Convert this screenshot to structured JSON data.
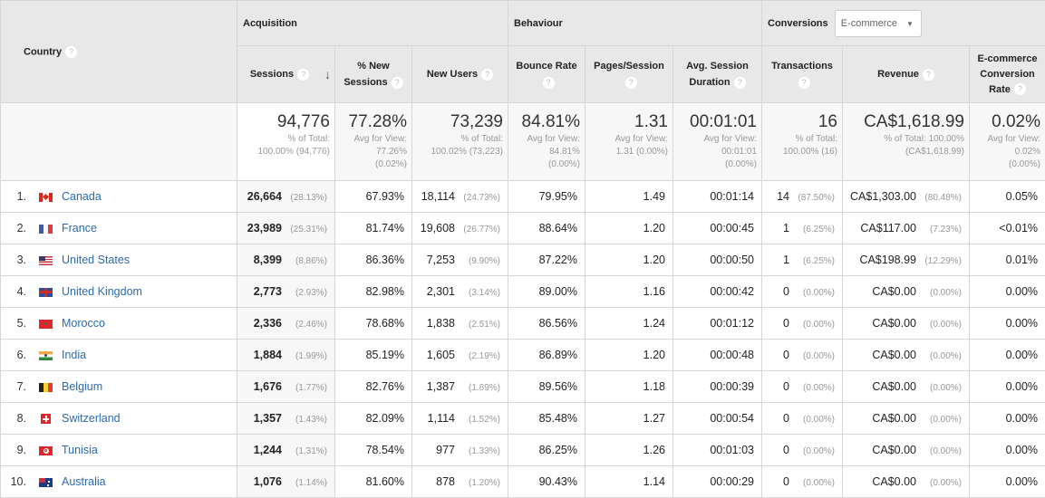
{
  "header": {
    "country_label": "Country",
    "groups": {
      "acquisition": "Acquisition",
      "behaviour": "Behaviour",
      "conversions": "Conversions"
    },
    "conversions_dropdown": {
      "selected": "E-commerce"
    },
    "columns": {
      "sessions": "Sessions",
      "pct_new_sessions": "% New Sessions",
      "new_users": "New Users",
      "bounce_rate": "Bounce Rate",
      "pages_session": "Pages/Session",
      "avg_session_duration": "Avg. Session Duration",
      "transactions": "Transactions",
      "revenue": "Revenue",
      "ecommerce_conversion_rate": "E-commerce Conversion Rate"
    },
    "help_glyph": "?",
    "sort_glyph": "↓"
  },
  "totals": {
    "sessions": {
      "value": "94,776",
      "sub1": "% of Total:",
      "sub2": "100.00% (94,776)"
    },
    "pct_new_sessions": {
      "value": "77.28%",
      "sub1": "Avg for View:",
      "sub2": "77.26%",
      "sub3": "(0.02%)"
    },
    "new_users": {
      "value": "73,239",
      "sub1": "% of Total:",
      "sub2": "100.02% (73,223)"
    },
    "bounce_rate": {
      "value": "84.81%",
      "sub1": "Avg for View:",
      "sub2": "84.81%",
      "sub3": "(0.00%)"
    },
    "pages_session": {
      "value": "1.31",
      "sub1": "Avg for View:",
      "sub2": "1.31 (0.00%)"
    },
    "avg_session_duration": {
      "value": "00:01:01",
      "sub1": "Avg for View:",
      "sub2": "00:01:01",
      "sub3": "(0.00%)"
    },
    "transactions": {
      "value": "16",
      "sub1": "% of Total:",
      "sub2": "100.00% (16)"
    },
    "revenue": {
      "value": "CA$1,618.99",
      "sub1": "% of Total: 100.00%",
      "sub2": "(CA$1,618.99)"
    },
    "ecommerce_conversion_rate": {
      "value": "0.02%",
      "sub1": "Avg for View:",
      "sub2": "0.02%",
      "sub3": "(0.00%)"
    }
  },
  "rows": [
    {
      "index": "1.",
      "flag": "canada-flag",
      "country": "Canada",
      "sessions": "26,664",
      "sessions_pct": "(28.13%)",
      "pct_new_sessions": "67.93%",
      "new_users": "18,114",
      "new_users_pct": "(24.73%)",
      "bounce_rate": "79.95%",
      "pages_session": "1.49",
      "avg_session_duration": "00:01:14",
      "transactions": "14",
      "transactions_pct": "(87.50%)",
      "revenue": "CA$1,303.00",
      "revenue_pct": "(80.48%)",
      "ecommerce_conversion_rate": "0.05%"
    },
    {
      "index": "2.",
      "flag": "france-flag",
      "country": "France",
      "sessions": "23,989",
      "sessions_pct": "(25.31%)",
      "pct_new_sessions": "81.74%",
      "new_users": "19,608",
      "new_users_pct": "(26.77%)",
      "bounce_rate": "88.64%",
      "pages_session": "1.20",
      "avg_session_duration": "00:00:45",
      "transactions": "1",
      "transactions_pct": "(6.25%)",
      "revenue": "CA$117.00",
      "revenue_pct": "(7.23%)",
      "ecommerce_conversion_rate": "<0.01%"
    },
    {
      "index": "3.",
      "flag": "united-states-flag",
      "country": "United States",
      "sessions": "8,399",
      "sessions_pct": "(8.86%)",
      "pct_new_sessions": "86.36%",
      "new_users": "7,253",
      "new_users_pct": "(9.90%)",
      "bounce_rate": "87.22%",
      "pages_session": "1.20",
      "avg_session_duration": "00:00:50",
      "transactions": "1",
      "transactions_pct": "(6.25%)",
      "revenue": "CA$198.99",
      "revenue_pct": "(12.29%)",
      "ecommerce_conversion_rate": "0.01%"
    },
    {
      "index": "4.",
      "flag": "united-kingdom-flag",
      "country": "United Kingdom",
      "sessions": "2,773",
      "sessions_pct": "(2.93%)",
      "pct_new_sessions": "82.98%",
      "new_users": "2,301",
      "new_users_pct": "(3.14%)",
      "bounce_rate": "89.00%",
      "pages_session": "1.16",
      "avg_session_duration": "00:00:42",
      "transactions": "0",
      "transactions_pct": "(0.00%)",
      "revenue": "CA$0.00",
      "revenue_pct": "(0.00%)",
      "ecommerce_conversion_rate": "0.00%"
    },
    {
      "index": "5.",
      "flag": "morocco-flag",
      "country": "Morocco",
      "sessions": "2,336",
      "sessions_pct": "(2.46%)",
      "pct_new_sessions": "78.68%",
      "new_users": "1,838",
      "new_users_pct": "(2.51%)",
      "bounce_rate": "86.56%",
      "pages_session": "1.24",
      "avg_session_duration": "00:01:12",
      "transactions": "0",
      "transactions_pct": "(0.00%)",
      "revenue": "CA$0.00",
      "revenue_pct": "(0.00%)",
      "ecommerce_conversion_rate": "0.00%"
    },
    {
      "index": "6.",
      "flag": "india-flag",
      "country": "India",
      "sessions": "1,884",
      "sessions_pct": "(1.99%)",
      "pct_new_sessions": "85.19%",
      "new_users": "1,605",
      "new_users_pct": "(2.19%)",
      "bounce_rate": "86.89%",
      "pages_session": "1.20",
      "avg_session_duration": "00:00:48",
      "transactions": "0",
      "transactions_pct": "(0.00%)",
      "revenue": "CA$0.00",
      "revenue_pct": "(0.00%)",
      "ecommerce_conversion_rate": "0.00%"
    },
    {
      "index": "7.",
      "flag": "belgium-flag",
      "country": "Belgium",
      "sessions": "1,676",
      "sessions_pct": "(1.77%)",
      "pct_new_sessions": "82.76%",
      "new_users": "1,387",
      "new_users_pct": "(1.89%)",
      "bounce_rate": "89.56%",
      "pages_session": "1.18",
      "avg_session_duration": "00:00:39",
      "transactions": "0",
      "transactions_pct": "(0.00%)",
      "revenue": "CA$0.00",
      "revenue_pct": "(0.00%)",
      "ecommerce_conversion_rate": "0.00%"
    },
    {
      "index": "8.",
      "flag": "switzerland-flag",
      "country": "Switzerland",
      "sessions": "1,357",
      "sessions_pct": "(1.43%)",
      "pct_new_sessions": "82.09%",
      "new_users": "1,114",
      "new_users_pct": "(1.52%)",
      "bounce_rate": "85.48%",
      "pages_session": "1.27",
      "avg_session_duration": "00:00:54",
      "transactions": "0",
      "transactions_pct": "(0.00%)",
      "revenue": "CA$0.00",
      "revenue_pct": "(0.00%)",
      "ecommerce_conversion_rate": "0.00%"
    },
    {
      "index": "9.",
      "flag": "tunisia-flag",
      "country": "Tunisia",
      "sessions": "1,244",
      "sessions_pct": "(1.31%)",
      "pct_new_sessions": "78.54%",
      "new_users": "977",
      "new_users_pct": "(1.33%)",
      "bounce_rate": "86.25%",
      "pages_session": "1.26",
      "avg_session_duration": "00:01:03",
      "transactions": "0",
      "transactions_pct": "(0.00%)",
      "revenue": "CA$0.00",
      "revenue_pct": "(0.00%)",
      "ecommerce_conversion_rate": "0.00%"
    },
    {
      "index": "10.",
      "flag": "australia-flag",
      "country": "Australia",
      "sessions": "1,076",
      "sessions_pct": "(1.14%)",
      "pct_new_sessions": "81.60%",
      "new_users": "878",
      "new_users_pct": "(1.20%)",
      "bounce_rate": "90.43%",
      "pages_session": "1.14",
      "avg_session_duration": "00:00:29",
      "transactions": "0",
      "transactions_pct": "(0.00%)",
      "revenue": "CA$0.00",
      "revenue_pct": "(0.00%)",
      "ecommerce_conversion_rate": "0.00%"
    }
  ]
}
